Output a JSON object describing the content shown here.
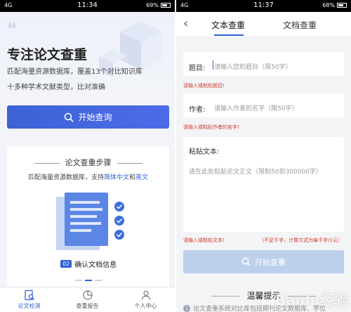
{
  "left": {
    "status": {
      "carrier": "4G",
      "time": "11:34",
      "battery": "69%"
    },
    "hero": {
      "title": "专注论文查重",
      "line1": "匹配海量资源数据库，覆盖13个对比知识库",
      "line2": "十多种学术文献类型，比对准确"
    },
    "start_button": "开始查询",
    "card": {
      "title": "论文查重步骤",
      "desc_prefix": "匹配海量资源数据库，支持",
      "desc_hl1": "简体中文",
      "desc_mid": "和",
      "desc_hl2": "英文",
      "step_num": "02",
      "step_label": "确认文档信息"
    },
    "tabs": [
      {
        "label": "论文检测",
        "icon": "doc-search-icon"
      },
      {
        "label": "查重报告",
        "icon": "report-chart-icon"
      },
      {
        "label": "个人中心",
        "icon": "user-icon"
      }
    ]
  },
  "right": {
    "status": {
      "carrier": "4G",
      "time": "11:37",
      "battery": "68%"
    },
    "nav": {
      "tab1": "文本查重",
      "tab2": "文档查重"
    },
    "title_field": {
      "label": "题目:",
      "placeholder": "请输入您的题目（限50字）",
      "error": "请输入或粘贴题目!"
    },
    "author_field": {
      "label": "作者:",
      "placeholder": "请输入作者的名字（限50字）",
      "error": "请输入或粘贴作者的名字!"
    },
    "text_field": {
      "label": "粘贴文本:",
      "placeholder": "请在此处粘贴论文正文（限制50到300000字）",
      "error": "请输入或粘贴文本!",
      "note": "（不足千字，计算方式为每千字/1元）"
    },
    "check_button": "开始查重",
    "tips": {
      "title": "温馨提示",
      "num": "1",
      "line1": "论文查重系统对比库包括期刊论文数据库、学位"
    }
  },
  "watermark": "Baidu经验",
  "colors": {
    "accent": "#2c5fd6",
    "error": "#d43a2a"
  }
}
